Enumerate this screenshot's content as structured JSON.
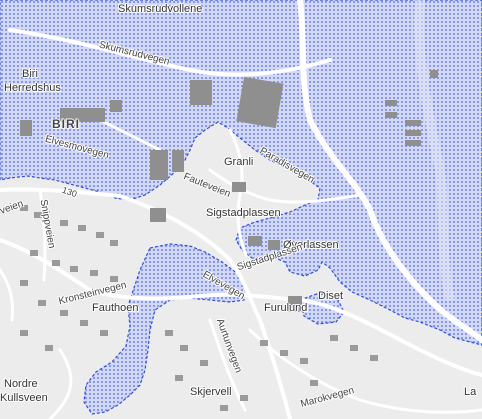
{
  "colors": {
    "base": "#ececec",
    "zone_dot": "#6f82e8",
    "zone_fill": "#c9cff0",
    "zone_border": "#2f4fd6",
    "building": "#8f8f8f",
    "road": "#ffffff"
  },
  "labels": {
    "skumsrudvollene": "Skumsrudvollene",
    "skumsrudvegen": "Skumsrudvegen",
    "biri": "Biri",
    "biri_herredshus": "Herredshus",
    "biri_big": "BIRI",
    "elvesmovegen": "Elvesmovegen",
    "granli": "Granli",
    "paradisvegen": "Paradisvegen",
    "fauteveien": "Fauteveien",
    "sigstadplassen": "Sigstadplassen",
    "odflassen": "Øverlassen",
    "sigstadplassen2": "Sigstadplassen",
    "snippveien": "Snippveien",
    "sveen": "veien",
    "kronsteinvegen": "Kronsteinvegen",
    "fauthoen": "Fauthoen",
    "elvevegen": "Elvevegen",
    "furulund": "Furulund",
    "diset": "Diset",
    "nordre": "Nordre",
    "kullsveen": "Kullsveen",
    "aurtunvegen": "Aurtunvegen",
    "skjervell": "Skjervell",
    "marokvegen": "Marokvegen",
    "la": "La",
    "e6": "130",
    "kveen": "lveen"
  }
}
